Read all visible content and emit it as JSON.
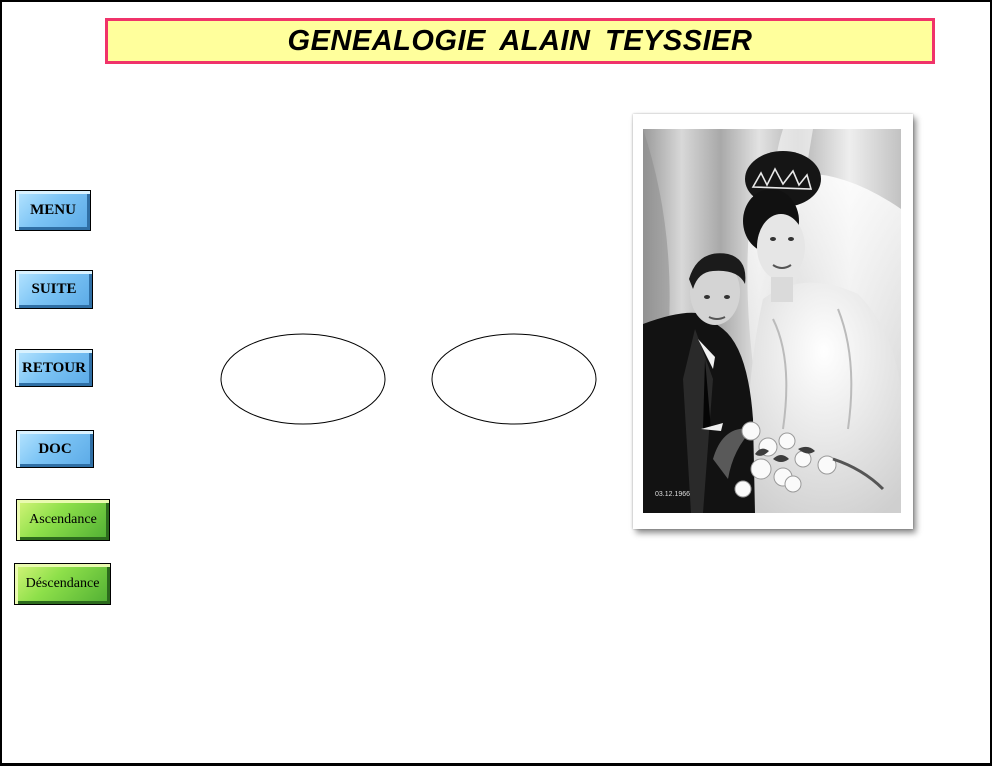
{
  "page": {
    "title": "GENEALOGIE  ALAIN  TEYSSIER",
    "colors": {
      "banner_bg": "#ffff9c",
      "banner_border": "#f0336a",
      "nav_button_blue": "#7cc4f5",
      "nav_button_green": "#8ee04a"
    }
  },
  "nav": {
    "menu": "MENU",
    "suite": "SUITE",
    "retour": "RETOUR",
    "doc": "DOC",
    "ascendance": "Ascendance",
    "descendance": "Déscendance"
  },
  "photo": {
    "date_stamp": "03.12.1966",
    "subject": "wedding-couple-photo"
  }
}
